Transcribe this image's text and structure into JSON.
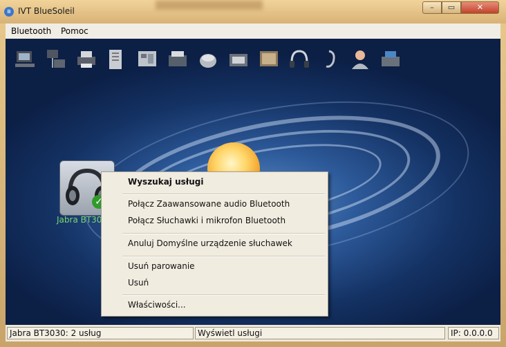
{
  "window": {
    "title": "IVT BlueSoleil"
  },
  "menubar": {
    "items": [
      "Bluetooth",
      "Pomoc"
    ]
  },
  "toolbar": {
    "icons": [
      "network-icon",
      "lan-icon",
      "printer-icon",
      "file-transfer-icon",
      "sync-icon",
      "fax-icon",
      "scanner-icon",
      "mouse-icon",
      "phone-icon",
      "image-icon",
      "headphones-icon",
      "headset-icon",
      "user-icon",
      "printer-share-icon"
    ]
  },
  "device": {
    "label": "Jabra BT3030"
  },
  "context_menu": {
    "items": [
      "Wyszukaj usługi",
      "Połącz Zaawansowane audio Bluetooth",
      "Połącz Słuchawki i mikrofon Bluetooth",
      "Anuluj Domyślne urządzenie słuchawek",
      "Usuń parowanie",
      "Usuń",
      "Właściwości..."
    ]
  },
  "statusbar": {
    "left": "Jabra BT3030: 2 usług",
    "middle": "Wyświetl usługi",
    "right": "IP: 0.0.0.0"
  }
}
